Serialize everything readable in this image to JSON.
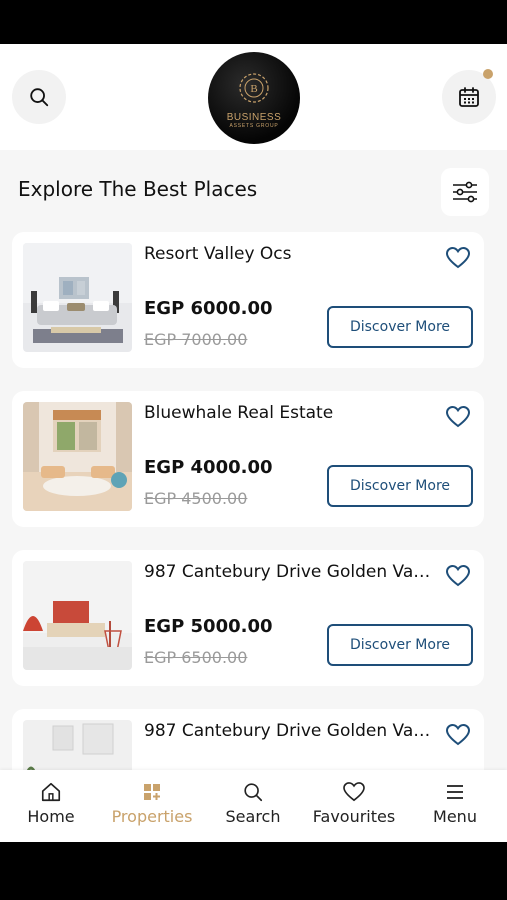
{
  "header": {
    "logo_main": "BUSINESS",
    "logo_sub": "ASSETS GROUP"
  },
  "section": {
    "title": "Explore The Best Places"
  },
  "listings": [
    {
      "title": "Resort Valley Ocs",
      "price": "EGP 6000.00",
      "old_price": "EGP 7000.00",
      "button": "Discover More"
    },
    {
      "title": "Bluewhale Real Estate",
      "price": "EGP 4000.00",
      "old_price": "EGP 4500.00",
      "button": "Discover More"
    },
    {
      "title": "987 Cantebury Drive Golden Vall...",
      "price": "EGP 5000.00",
      "old_price": "EGP 6500.00",
      "button": "Discover More"
    },
    {
      "title": "987 Cantebury Drive Golden Vall...",
      "price": "",
      "old_price": "",
      "button": ""
    }
  ],
  "nav": {
    "items": [
      {
        "label": "Home",
        "icon": "home-icon"
      },
      {
        "label": "Properties",
        "icon": "grid-icon",
        "active": true
      },
      {
        "label": "Search",
        "icon": "search-icon"
      },
      {
        "label": "Favourites",
        "icon": "heart-icon"
      },
      {
        "label": "Menu",
        "icon": "menu-icon"
      }
    ]
  },
  "colors": {
    "accent": "#c9a26b",
    "button_blue": "#1e4e79",
    "background": "#f6f6f6"
  }
}
